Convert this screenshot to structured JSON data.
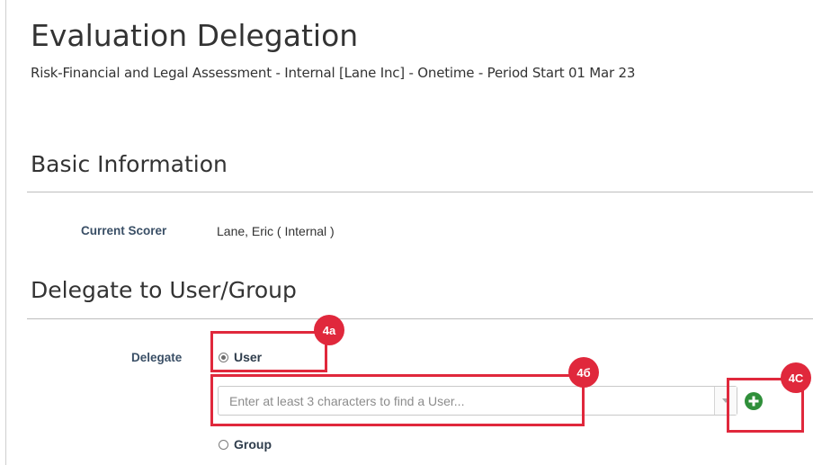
{
  "header": {
    "title": "Evaluation Delegation",
    "subtitle": "Risk-Financial and Legal Assessment - Internal [Lane Inc] - Onetime - Period Start 01 Mar 23"
  },
  "basic_info": {
    "section_title": "Basic Information",
    "current_scorer_label": "Current Scorer",
    "current_scorer_value": "Lane, Eric  ( Internal )"
  },
  "delegate": {
    "section_title": "Delegate to User/Group",
    "delegate_label": "Delegate",
    "options": [
      {
        "label": "User",
        "checked": true
      },
      {
        "label": "Group",
        "checked": false
      }
    ],
    "search": {
      "placeholder": "Enter at least 3 characters to find a User...",
      "value": ""
    },
    "add_icon": "plus-circle-icon"
  },
  "annotations": {
    "badge_4a": "4a",
    "badge_4b": "4б",
    "badge_4c": "4C"
  },
  "colors": {
    "callout_red": "#e0283c",
    "add_green": "#2f8f3a",
    "label_blue": "#3a4f66"
  }
}
